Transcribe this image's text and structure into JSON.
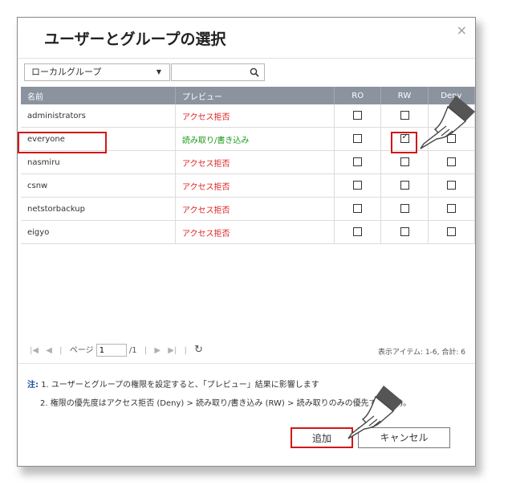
{
  "dialog": {
    "title": "ユーザーとグループの選択",
    "close": "×"
  },
  "filter": {
    "group_select": "ローカルグループ",
    "search_value": ""
  },
  "table": {
    "headers": {
      "name": "名前",
      "preview": "プレビュー",
      "ro": "RO",
      "rw": "RW",
      "deny": "Deny"
    },
    "rows": [
      {
        "name": "administrators",
        "preview": "アクセス拒否",
        "ro": false,
        "rw": false,
        "deny": false
      },
      {
        "name": "everyone",
        "preview": "読み取り/書き込み",
        "ro": false,
        "rw": true,
        "deny": false
      },
      {
        "name": "nasmiru",
        "preview": "アクセス拒否",
        "ro": false,
        "rw": false,
        "deny": false
      },
      {
        "name": "csnw",
        "preview": "アクセス拒否",
        "ro": false,
        "rw": false,
        "deny": false
      },
      {
        "name": "netstorbackup",
        "preview": "アクセス拒否",
        "ro": false,
        "rw": false,
        "deny": false
      },
      {
        "name": "eigyo",
        "preview": "アクセス拒否",
        "ro": false,
        "rw": false,
        "deny": false
      }
    ]
  },
  "pager": {
    "page_label": "ページ",
    "page_value": "1",
    "total": "/1",
    "items": "表示アイテム: 1-6, 合計: 6"
  },
  "notes": {
    "label": "注:",
    "line1": "1. ユーザーとグループの権限を設定すると、「プレビュー」結果に影響します",
    "line2": "2. 権限の優先度はアクセス拒否 (Deny) > 読み取り/書き込み (RW) > 読み取りのみの優先です(RO)。"
  },
  "buttons": {
    "add": "追加",
    "cancel": "キャンセル"
  },
  "colors": {
    "header_bg": "#8b939f",
    "deny_text": "#e02020",
    "rw_text": "#1a9a1a",
    "highlight": "#d01818"
  }
}
